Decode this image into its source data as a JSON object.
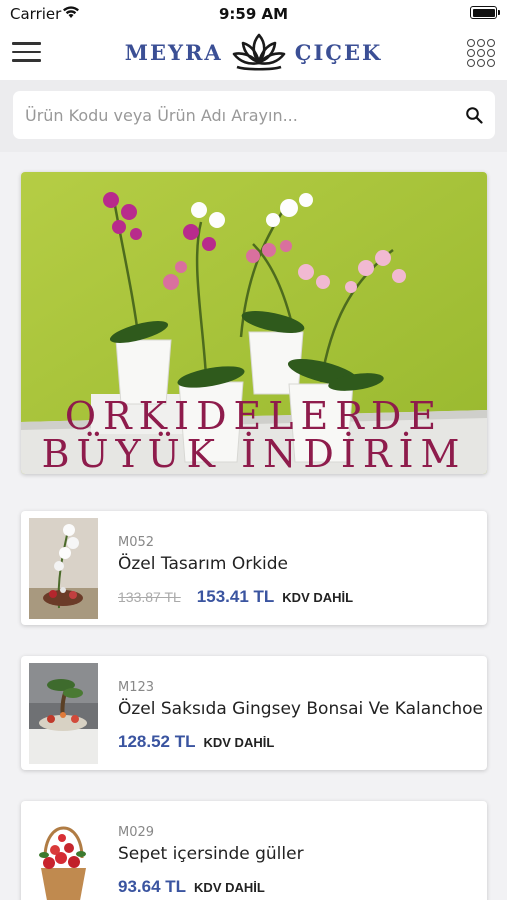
{
  "status_bar": {
    "carrier": "Carrier",
    "time": "9:59 AM"
  },
  "header": {
    "logo_left": "MEYRA",
    "logo_right": "ÇIÇEK"
  },
  "search": {
    "placeholder": "Ürün Kodu veya Ürün Adı Arayın...",
    "value": ""
  },
  "banner": {
    "line1": "ORKIDELERDE",
    "line2": "BÜYÜK İNDİRİM"
  },
  "products": [
    {
      "code": "M052",
      "name": "Özel Tasarım Orkide",
      "old_price": "133.87 TL",
      "price": "153.41 TL",
      "vat": "KDV DAHİL"
    },
    {
      "code": "M123",
      "name": "Özel Saksıda Gingsey Bonsai Ve Kalanchoe",
      "price": "128.52 TL",
      "vat": "KDV DAHİL"
    },
    {
      "code": "M029",
      "name": "Sepet içersinde güller",
      "price": "93.64 TL",
      "vat": "KDV DAHİL"
    }
  ],
  "colors": {
    "brand": "#3b4f95",
    "price": "#3a54a0",
    "banner_text": "#8e1c4c",
    "banner_bg": "#a8c43a"
  },
  "icons": [
    "wifi-icon",
    "battery-icon",
    "menu-icon",
    "lotus-logo-icon",
    "grid-icon",
    "search-icon"
  ]
}
